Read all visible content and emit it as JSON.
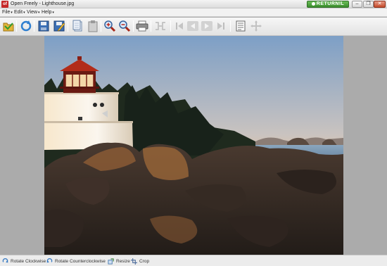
{
  "window": {
    "app_icon_text": "of",
    "title": "Open Freely - Lighthouse.jpg",
    "brand": "RETURNIL",
    "minimize_glyph": "–",
    "restore_glyph": "❐",
    "close_glyph": "✕"
  },
  "menu": [
    {
      "label": "File"
    },
    {
      "label": "Edit"
    },
    {
      "label": "View"
    },
    {
      "label": "Help"
    }
  ],
  "toolbar": {
    "icons": [
      "open-icon",
      "refresh-icon",
      "save-icon",
      "save-as-icon",
      "copy-icon",
      "paste-icon",
      "zoom-in-icon",
      "zoom-out-icon",
      "print-icon",
      "fit-icon",
      "first-page-icon",
      "previous-page-icon",
      "next-page-icon",
      "last-page-icon",
      "thumbnails-icon",
      "pan-icon"
    ]
  },
  "image": {
    "filename": "Lighthouse.jpg",
    "colors": {
      "sky_top": "#7fa3c9",
      "sky_horizon": "#f2c08a",
      "sea": "#6a8aa6",
      "tower": "#f6efe2",
      "lamp_roof": "#b22c1a",
      "rocks": "#3a2f28"
    }
  },
  "status": {
    "rotate_cw": "Rotate Clockwise",
    "rotate_ccw": "Rotate Counterclockwise",
    "resize": "Resize",
    "crop": "Crop"
  },
  "colors": {
    "brand_green": "#3a8c2c",
    "close_red": "#c44b2c",
    "background": "#ababab"
  }
}
